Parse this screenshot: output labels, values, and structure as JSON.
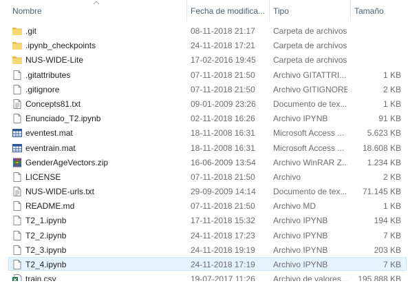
{
  "columns": {
    "name": "Nombre",
    "date": "Fecha de modifica...",
    "type": "Tipo",
    "size": "Tamaño"
  },
  "colors": {
    "header_text": "#4c607a",
    "hover_bg": "#e5f3ff",
    "hover_border": "#cce8ff",
    "folder": "#f8d775"
  },
  "files": [
    {
      "name": ".git",
      "date": "08-11-2018 21:17",
      "type": "Carpeta de archivos",
      "size": "",
      "icon": "folder-icon"
    },
    {
      "name": ".ipynb_checkpoints",
      "date": "24-11-2018 17:21",
      "type": "Carpeta de archivos",
      "size": "",
      "icon": "folder-icon"
    },
    {
      "name": "NUS-WIDE-Lite",
      "date": "17-02-2016 19:45",
      "type": "Carpeta de archivos",
      "size": "",
      "icon": "folder-icon"
    },
    {
      "name": ".gitattributes",
      "date": "07-11-2018 21:50",
      "type": "Archivo GITATTRI...",
      "size": "1 KB",
      "icon": "file-icon"
    },
    {
      "name": ".gitignore",
      "date": "07-11-2018 21:50",
      "type": "Archivo GITIGNORE",
      "size": "2 KB",
      "icon": "file-icon"
    },
    {
      "name": "Concepts81.txt",
      "date": "09-01-2009 23:26",
      "type": "Documento de tex...",
      "size": "1 KB",
      "icon": "text-file-icon"
    },
    {
      "name": "Enunciado_T2.ipynb",
      "date": "02-11-2018 16:26",
      "type": "Archivo IPYNB",
      "size": "91 KB",
      "icon": "file-icon"
    },
    {
      "name": "eventest.mat",
      "date": "18-11-2008 16:31",
      "type": "Microsoft Access ...",
      "size": "5.623 KB",
      "icon": "access-table-icon"
    },
    {
      "name": "eventrain.mat",
      "date": "18-11-2008 16:31",
      "type": "Microsoft Access ...",
      "size": "18.608 KB",
      "icon": "access-table-icon"
    },
    {
      "name": "GenderAgeVectors.zip",
      "date": "16-06-2009 13:54",
      "type": "Archivo WinRAR Z...",
      "size": "1.234 KB",
      "icon": "winrar-icon"
    },
    {
      "name": "LICENSE",
      "date": "07-11-2018 21:50",
      "type": "Archivo",
      "size": "2 KB",
      "icon": "file-icon"
    },
    {
      "name": "NUS-WIDE-urls.txt",
      "date": "29-09-2009 14:14",
      "type": "Documento de tex...",
      "size": "71.145 KB",
      "icon": "text-file-icon"
    },
    {
      "name": "README.md",
      "date": "07-11-2018 21:50",
      "type": "Archivo MD",
      "size": "1 KB",
      "icon": "file-icon"
    },
    {
      "name": "T2_1.ipynb",
      "date": "17-11-2018 15:32",
      "type": "Archivo IPYNB",
      "size": "194 KB",
      "icon": "file-icon"
    },
    {
      "name": "T2_2.ipynb",
      "date": "24-11-2018 17:23",
      "type": "Archivo IPYNB",
      "size": "7 KB",
      "icon": "file-icon"
    },
    {
      "name": "T2_3.ipynb",
      "date": "24-11-2018 19:19",
      "type": "Archivo IPYNB",
      "size": "203 KB",
      "icon": "file-icon"
    },
    {
      "name": "T2_4.ipynb",
      "date": "24-11-2018 17:19",
      "type": "Archivo IPYNB",
      "size": "7 KB",
      "icon": "file-icon",
      "hover": true
    },
    {
      "name": "train.csv",
      "date": "19-07-2017 11:26",
      "type": "Archivo de valores...",
      "size": "195.888 KB",
      "icon": "excel-csv-icon"
    }
  ]
}
